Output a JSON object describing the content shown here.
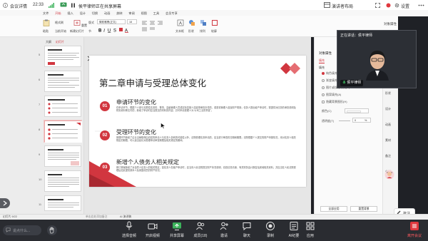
{
  "topbar": {
    "app_label": "会议详情",
    "time": "22:33",
    "sharing_text": "侯平律师正在共享屏幕",
    "speaker_view": "演讲者布局",
    "settings": "设置"
  },
  "ppt": {
    "tabs": [
      "文件",
      "开始",
      "插入",
      "设计",
      "切换",
      "动画",
      "放映",
      "审阅",
      "视图",
      "工具",
      "会员专享"
    ],
    "ribbon": {
      "paste": "粘贴",
      "format_painter": "格式刷",
      "from_current": "当前开始",
      "new_slide": "新建幻灯片",
      "layout": "版式",
      "section": "节",
      "reset": "重置",
      "font_name": "微软雅黑(正文)",
      "font_size": "18",
      "text_box": "文本框",
      "shape": "形状",
      "arrange": "排列",
      "outline": "轮廓",
      "object_attr": "对象属性"
    }
  },
  "leftpane": {
    "tab_outline": "大纲",
    "tab_slides": "幻灯片",
    "slide_numbers": [
      "5",
      "6",
      "7",
      "8",
      "9",
      "10",
      "11"
    ],
    "add_slide": "+"
  },
  "slide": {
    "title": "第二章申请与受理总体变化",
    "sections": [
      {
        "num": "01",
        "heading": "申请环节的变化",
        "body": "在申请环节，根据个人参与无限性债务的，董事、高级管理人员或实际控制人如连带承担责任的，或是将管理人选及财产规则；债务人提出破产申请时，需提供对债务的承担说明及财务资料等文件的，新增了申请时应当提交的材料的内容，并可申请受理人为“公司工业的事宜”。"
      },
      {
        "num": "02",
        "heading": "受理环节的变化",
        "body": "受理环节新增了企业当局取得由债权的申请人与债务人协商的可能性以外，法院受理债务申请的，应当进行审查的日期和期限；法院根据个人提交的财产申报情况，未对债务人相关规定的期限，可以适当延长对受理申请审查期限及相关规定的期间。"
      },
      {
        "num": "03",
        "heading": "新增个人债务人相关规定",
        "body": "修订草案新增了对自然人债务人的相关规定，如债务人在破产申请时，应当向人民法院提交财产状况说明、债权债务清册、有关财务会计报告及其他相关资料，并应当在人民法院受理后如实提供其本人及家庭成员的财产情况。"
      }
    ]
  },
  "rightpanel": {
    "title": "对象属性",
    "tab_fill": "填充",
    "section_fill": "填充",
    "options": [
      "纯色填充(S)",
      "渐变填充(G)",
      "图片或纹理填充(P)",
      "图案填充(A)",
      "隐藏背景图形(H)"
    ],
    "color_label": "颜色(C)",
    "transparency_label": "透明度(T)",
    "transparency_value": "0",
    "transparency_unit": "%",
    "apply_all": "全部应用",
    "reset_bg": "重置背景"
  },
  "righticons": [
    "形状",
    "设计",
    "动画",
    "素材",
    "备注",
    "分享"
  ],
  "video": {
    "speaking_label": "正在讲话：侯平律师",
    "name": "侯平律师"
  },
  "statusbar": {
    "left": "幻灯片 9/22",
    "notes_hint": "单击此处添加备注",
    "ai_hint": "AI 演讲稿"
  },
  "annotate": "批注",
  "bottombar": {
    "chat_placeholder": "说点什么...",
    "items": [
      "选择音频",
      "开启视频",
      "共享屏幕",
      "成员(18)",
      "邀请",
      "聊天",
      "录制",
      "AI纪要",
      "应用"
    ],
    "end": "离开会议"
  }
}
